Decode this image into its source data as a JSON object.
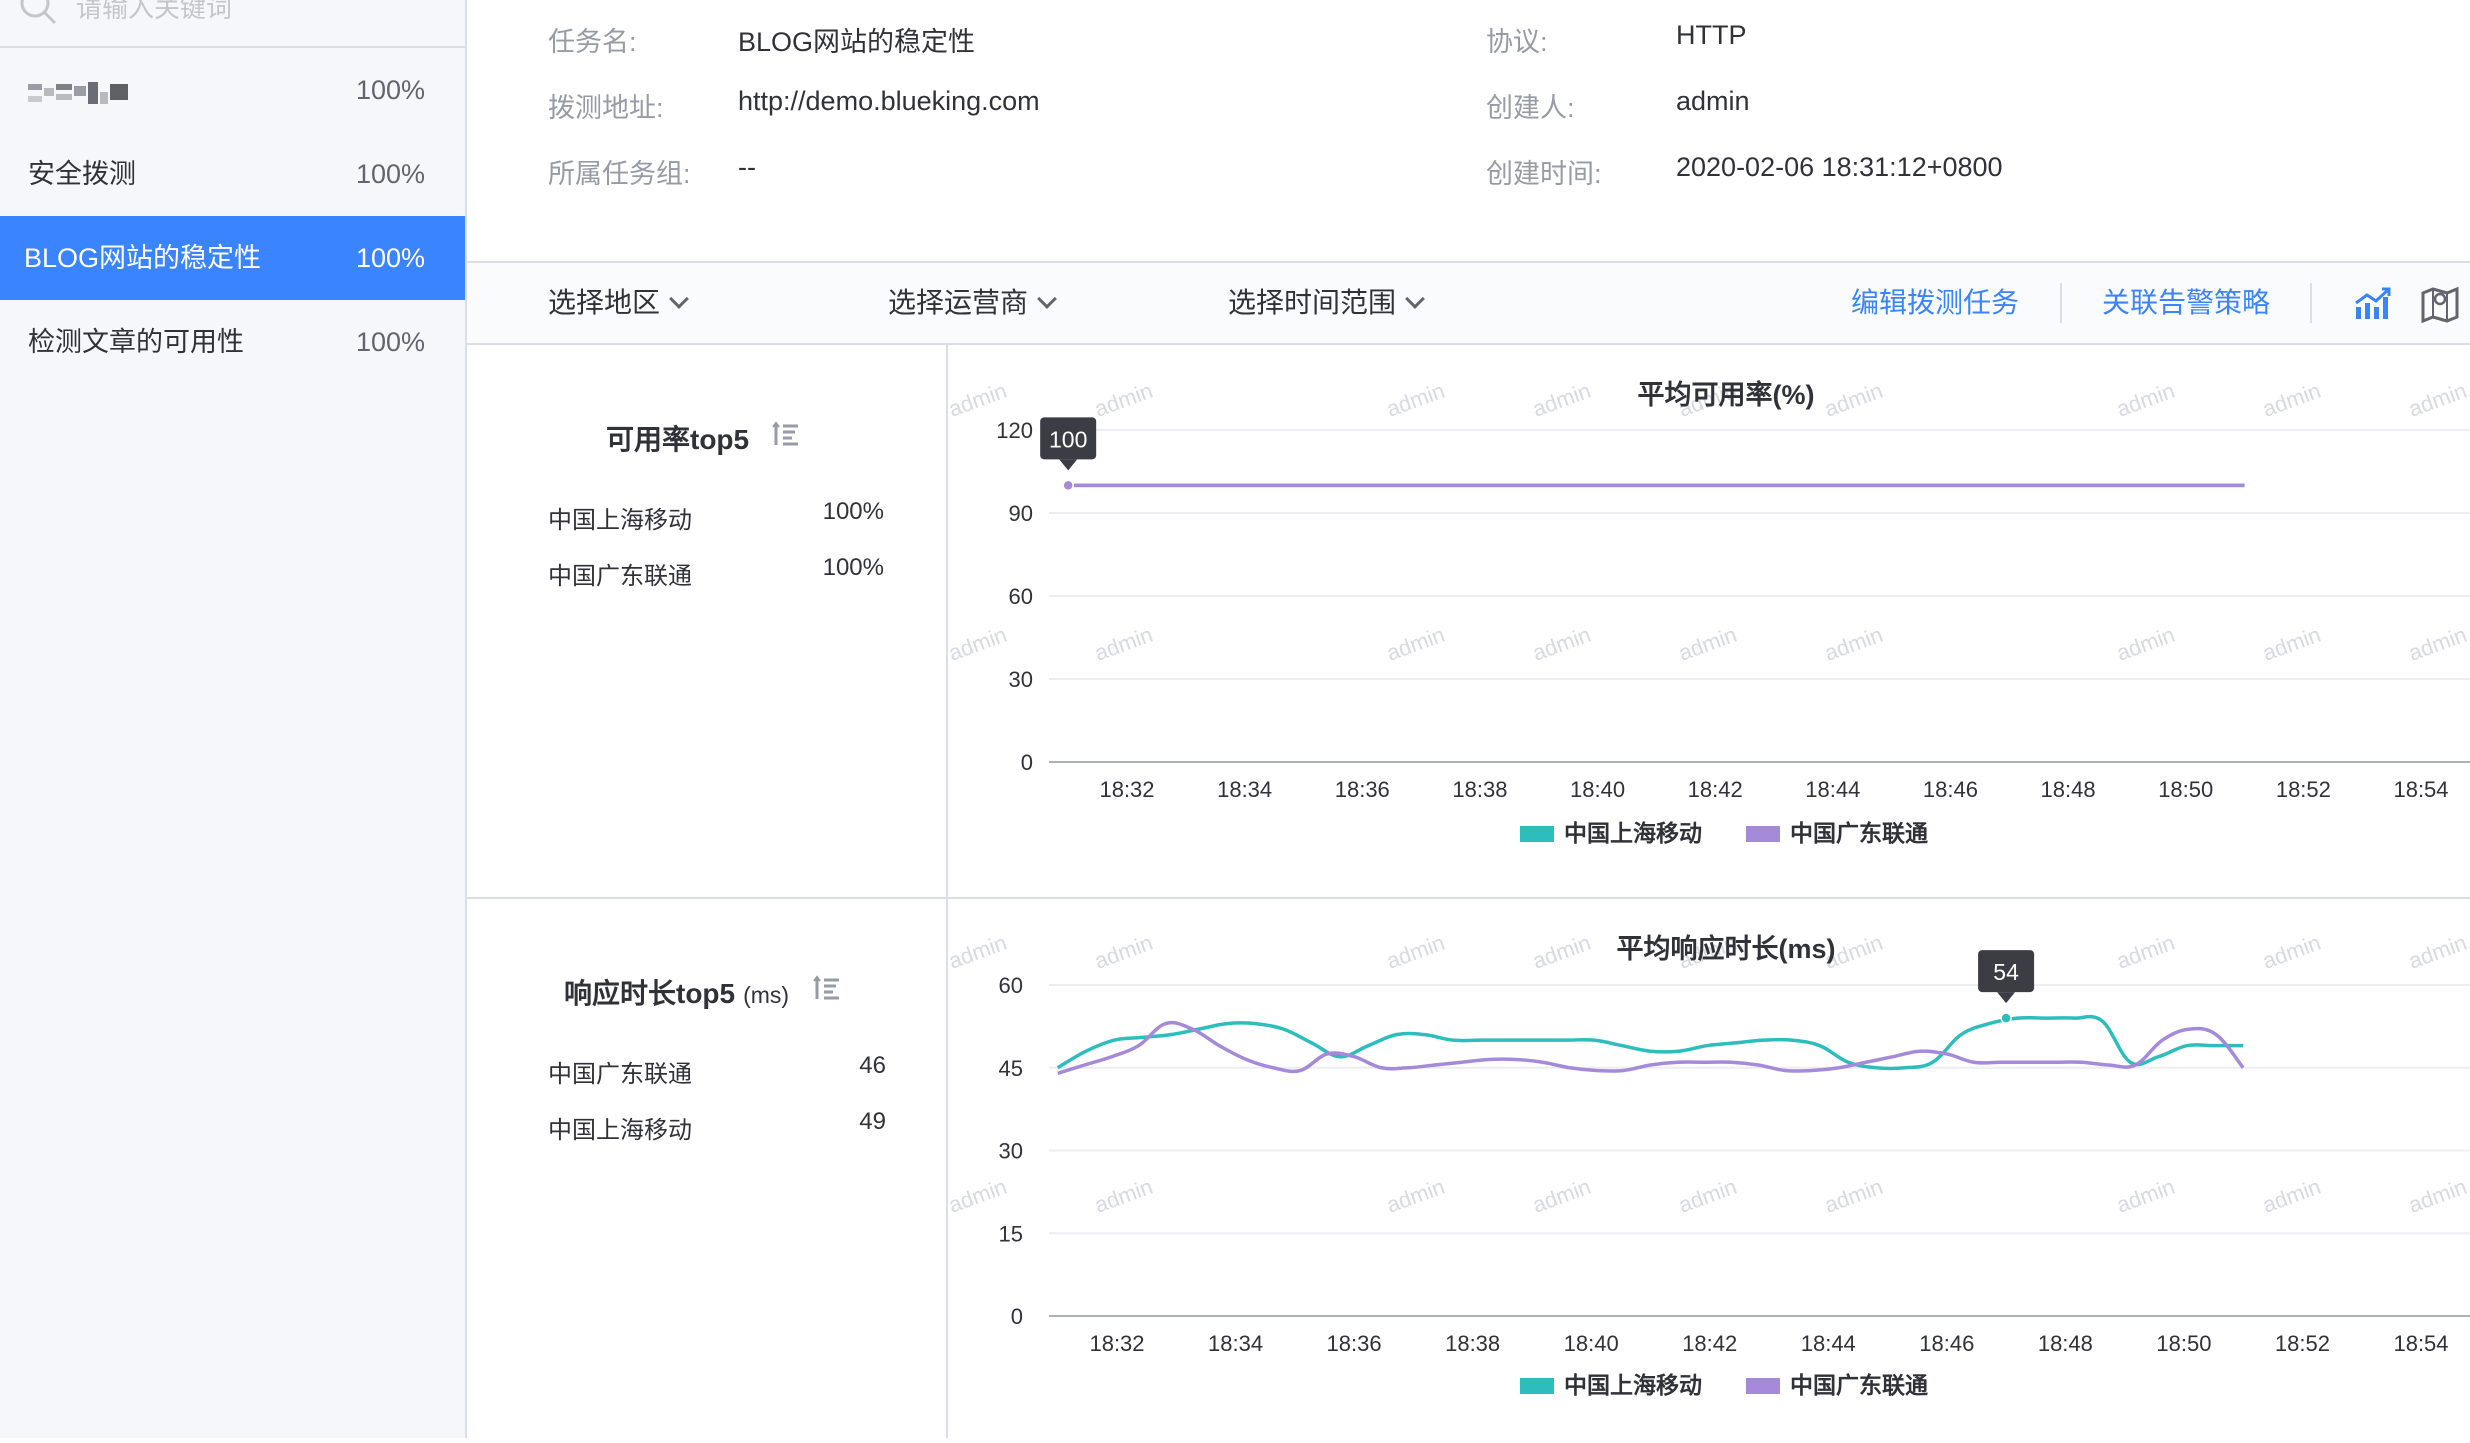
{
  "sidebar": {
    "search_placeholder": "请输入关键词",
    "items": [
      {
        "label": "",
        "percent": "100%",
        "blurred": true
      },
      {
        "label": "安全拨测",
        "percent": "100%"
      },
      {
        "label": "BLOG网站的稳定性",
        "percent": "100%",
        "active": true
      },
      {
        "label": "检测文章的可用性",
        "percent": "100%"
      }
    ]
  },
  "info": {
    "task_name_label": "任务名:",
    "task_name": "BLOG网站的稳定性",
    "url_label": "拨测地址:",
    "url": "http://demo.blueking.com",
    "group_label": "所属任务组:",
    "group": "--",
    "protocol_label": "协议:",
    "protocol": "HTTP",
    "creator_label": "创建人:",
    "creator": "admin",
    "created_label": "创建时间:",
    "created": "2020-02-06 18:31:12+0800"
  },
  "filters": {
    "region": "选择地区",
    "carrier": "选择运营商",
    "time_range": "选择时间范围",
    "edit_task": "编辑拨测任务",
    "link_alert": "关联告警策略"
  },
  "availability_top": {
    "title": "可用率top5",
    "rows": [
      {
        "name": "中国上海移动",
        "value": "100%"
      },
      {
        "name": "中国广东联通",
        "value": "100%"
      }
    ]
  },
  "response_top": {
    "title": "响应时长top5",
    "unit": "(ms)",
    "rows": [
      {
        "name": "中国广东联通",
        "value": "46"
      },
      {
        "name": "中国上海移动",
        "value": "49"
      }
    ]
  },
  "watermark": "admin",
  "colors": {
    "accent": "#3a84ff",
    "series_shanghai": "#2dbdbd",
    "series_guangdong": "#a48ad9"
  },
  "chart_data": [
    {
      "type": "line",
      "title": "平均可用率(%)",
      "x_ticks": [
        "18:32",
        "18:34",
        "18:36",
        "18:38",
        "18:40",
        "18:42",
        "18:44",
        "18:46",
        "18:48",
        "18:50",
        "18:52",
        "18:54"
      ],
      "y_ticks": [
        0,
        30,
        60,
        90,
        120
      ],
      "ylim": [
        0,
        120
      ],
      "xlim_minutes": [
        18.5,
        54
      ],
      "x": [
        "18:31",
        "18:33",
        "18:35",
        "18:37",
        "18:39",
        "18:41",
        "18:43",
        "18:45",
        "18:47",
        "18:49",
        "18:51"
      ],
      "series": [
        {
          "name": "中国上海移动",
          "values": [
            100,
            100,
            100,
            100,
            100,
            100,
            100,
            100,
            100,
            100,
            100
          ]
        },
        {
          "name": "中国广东联通",
          "values": [
            100,
            100,
            100,
            100,
            100,
            100,
            100,
            100,
            100,
            100,
            100
          ]
        }
      ],
      "tooltip": {
        "x": "18:31",
        "value": "100"
      },
      "legend": "bottom"
    },
    {
      "type": "line",
      "title": "平均响应时长(ms)",
      "x_ticks": [
        "18:32",
        "18:34",
        "18:36",
        "18:38",
        "18:40",
        "18:42",
        "18:44",
        "18:46",
        "18:48",
        "18:50",
        "18:52",
        "18:54"
      ],
      "y_ticks": [
        0,
        15,
        30,
        45,
        60
      ],
      "ylim": [
        0,
        60
      ],
      "x": [
        "18:31",
        "18:31.5",
        "18:32",
        "18:32.5",
        "18:33",
        "18:33.5",
        "18:34",
        "18:34.5",
        "18:35",
        "18:35.5",
        "18:36",
        "18:36.5",
        "18:37",
        "18:37.5",
        "18:38",
        "18:38.5",
        "18:39",
        "18:39.5",
        "18:40",
        "18:40.5",
        "18:41",
        "18:41.5",
        "18:42",
        "18:42.5",
        "18:43",
        "18:43.5",
        "18:44",
        "18:44.5",
        "18:45",
        "18:45.5",
        "18:46",
        "18:46.5",
        "18:47",
        "18:47.5",
        "18:48",
        "18:48.5",
        "18:49",
        "18:49.5",
        "18:50",
        "18:50.5",
        "18:51"
      ],
      "series": [
        {
          "name": "中国上海移动",
          "values": [
            45,
            48,
            50,
            50.5,
            51,
            52,
            53,
            53,
            52,
            49.5,
            47,
            49,
            51,
            51,
            50,
            50,
            50,
            50,
            50,
            50,
            49,
            48,
            48,
            49,
            49.5,
            50,
            50,
            49,
            46,
            45,
            45,
            46,
            51,
            53,
            54,
            54,
            54,
            53.5,
            46,
            47,
            49,
            49,
            49
          ]
        },
        {
          "name": "中国广东联通",
          "values": [
            44,
            45.5,
            47,
            49,
            53,
            52,
            49,
            46.5,
            45,
            44.5,
            47.5,
            47,
            45,
            45,
            45.5,
            46,
            46.5,
            46.5,
            46,
            45,
            44.5,
            44.5,
            45.5,
            46,
            46,
            46,
            45.5,
            44.5,
            44.5,
            45,
            46,
            47,
            48,
            47.5,
            46,
            46,
            46,
            46,
            46,
            45.5,
            45.5,
            50,
            52,
            51,
            45
          ]
        }
      ],
      "tooltip": {
        "x": "18:47",
        "value": "54"
      },
      "legend": "bottom"
    }
  ]
}
